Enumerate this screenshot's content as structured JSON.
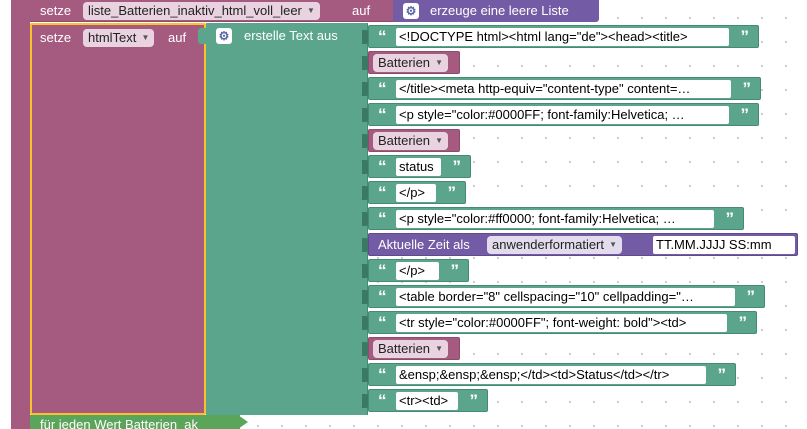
{
  "top_block": {
    "keyword": "setze",
    "variable": "liste_Batterien_inaktiv_html_voll_leer",
    "to": "auf",
    "value_label": "erzeuge eine leere Liste"
  },
  "set_block": {
    "keyword": "setze",
    "variable": "htmlText",
    "to": "auf",
    "create_text_label": "erstelle Text aus"
  },
  "items": [
    {
      "kind": "string",
      "text": "<!DOCTYPE html><html lang=\"de\"><head><title>"
    },
    {
      "kind": "var",
      "text": "Batterien"
    },
    {
      "kind": "string",
      "text": "</title><meta http-equiv=\"content-type\" content=…"
    },
    {
      "kind": "string",
      "text": "<p style=\"color:#0000FF; font-family:Helvetica; …"
    },
    {
      "kind": "var",
      "text": "Batterien"
    },
    {
      "kind": "string",
      "text": "status"
    },
    {
      "kind": "string",
      "text": "</p>"
    },
    {
      "kind": "string",
      "text": "<p style=\"color:#ff0000; font-family:Helvetica; …"
    },
    {
      "kind": "time",
      "label": "Aktuelle Zeit als",
      "format_mode": "anwenderformatiert",
      "format": "TT.MM.JJJJ SS:mm"
    },
    {
      "kind": "string",
      "text": " </p>"
    },
    {
      "kind": "string",
      "text": "<table border=\"8\" cellspacing=\"10\" cellpadding=\"…"
    },
    {
      "kind": "string",
      "text": "<tr style=\"color:#0000FF\"; font-weight: bold\"><td>"
    },
    {
      "kind": "var",
      "text": "Batterien"
    },
    {
      "kind": "string",
      "text": "&ensp;&ensp;&ensp;</td><td>Status</td></tr>"
    },
    {
      "kind": "string",
      "text": "<tr><td>"
    }
  ],
  "bottom_block": {
    "label": "für jeden Wert Batterien_ak"
  },
  "colors": {
    "variables": "#a55b80",
    "text": "#5ba58c",
    "list": "#745ba5",
    "loop": "#5ba55b",
    "selection": "#fbc02d"
  }
}
